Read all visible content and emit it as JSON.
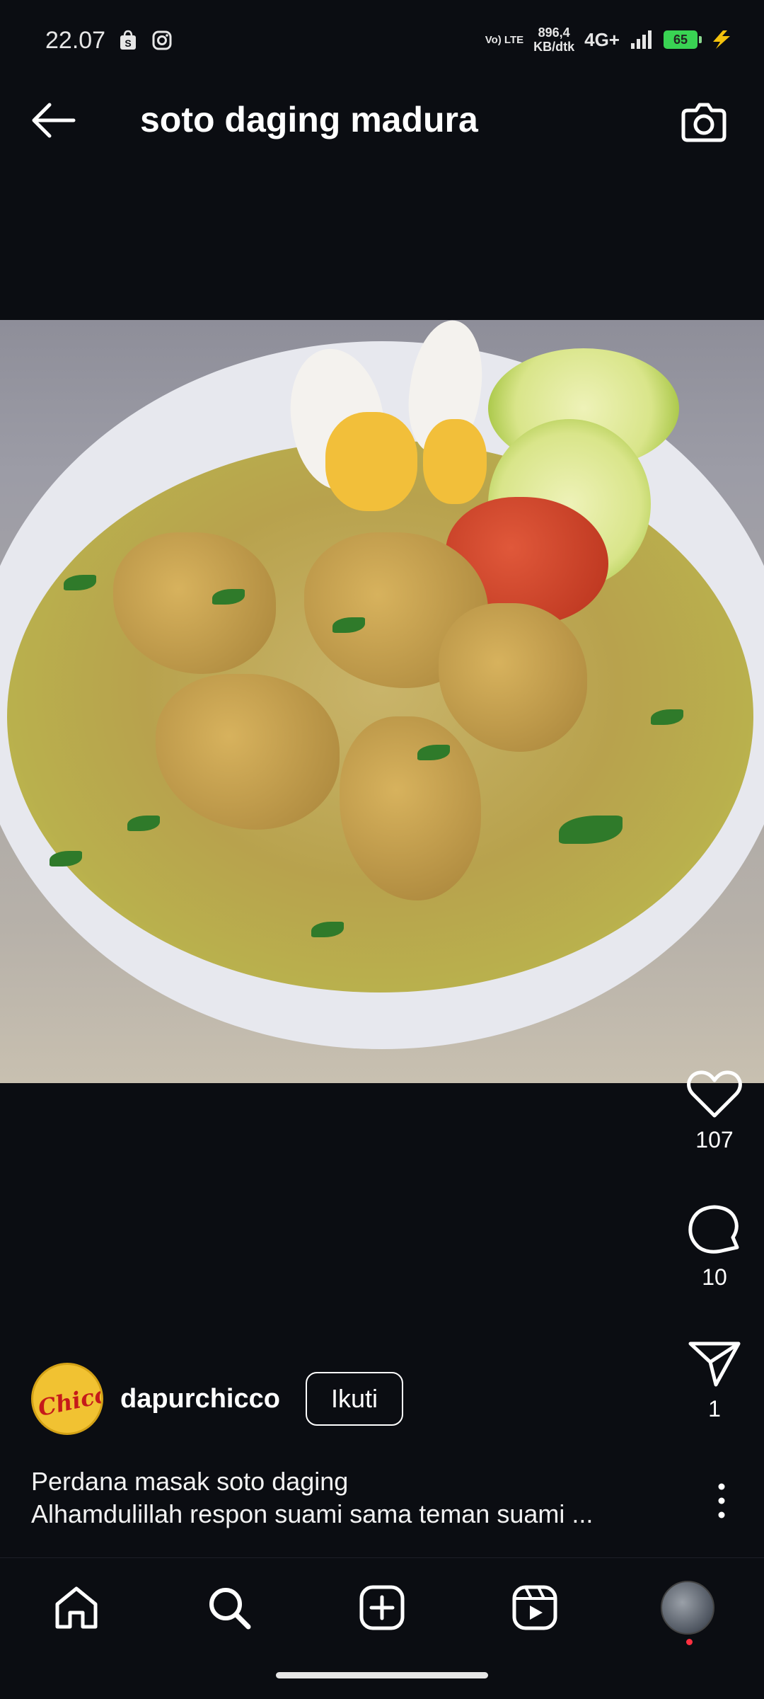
{
  "status": {
    "time": "22.07",
    "volte": "Vo) LTE",
    "net_speed_value": "896,4",
    "net_speed_unit": "KB/dtk",
    "network": "4G+",
    "battery": "65"
  },
  "header": {
    "title": "soto daging madura"
  },
  "post": {
    "likes": "107",
    "comments": "10",
    "shares": "1",
    "username": "dapurchicco",
    "avatar_text": "Chicco",
    "follow_label": "Ikuti",
    "caption_line1": "Perdana masak soto daging",
    "caption_line2": "Alhamdulillah respon suami sama teman suami ..."
  },
  "icons": {
    "back": "arrow-left-icon",
    "camera": "camera-icon",
    "like": "heart-icon",
    "comment": "comment-icon",
    "share": "send-icon",
    "more": "more-vertical-icon",
    "nav": [
      "home-icon",
      "search-icon",
      "add-icon",
      "reels-icon",
      "profile-avatar"
    ]
  },
  "colors": {
    "background": "#0b0d12",
    "text": "#ffffff",
    "notification_dot": "#ff3040",
    "battery": "#39d353"
  }
}
